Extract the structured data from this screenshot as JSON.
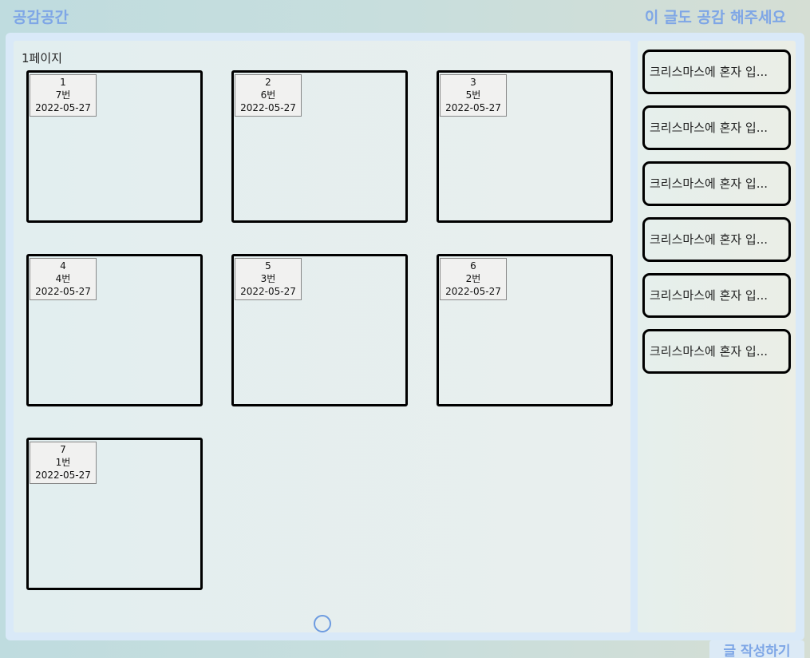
{
  "app_title": "공감공간",
  "side_title": "이 글도 공감 해주세요",
  "main": {
    "page_indicator": "1페이지",
    "cards": [
      {
        "index": "1",
        "number": "7번",
        "date": "2022-05-27"
      },
      {
        "index": "2",
        "number": "6번",
        "date": "2022-05-27"
      },
      {
        "index": "3",
        "number": "5번",
        "date": "2022-05-27"
      },
      {
        "index": "4",
        "number": "4번",
        "date": "2022-05-27"
      },
      {
        "index": "5",
        "number": "3번",
        "date": "2022-05-27"
      },
      {
        "index": "6",
        "number": "2번",
        "date": "2022-05-27"
      },
      {
        "index": "7",
        "number": "1번",
        "date": "2022-05-27"
      }
    ],
    "loading_icon": "circle-outline"
  },
  "sidebar": {
    "items": [
      {
        "label": "크리스마스에 혼자 입..."
      },
      {
        "label": "크리스마스에 혼자 입..."
      },
      {
        "label": "크리스마스에 혼자 입..."
      },
      {
        "label": "크리스마스에 혼자 입..."
      },
      {
        "label": "크리스마스에 혼자 입..."
      },
      {
        "label": "크리스마스에 혼자 입..."
      }
    ]
  },
  "write_button_label": "글 작성하기",
  "colors": {
    "accent": "#7ea6e6",
    "frame": "#d9e9f8",
    "border": "#000000"
  }
}
